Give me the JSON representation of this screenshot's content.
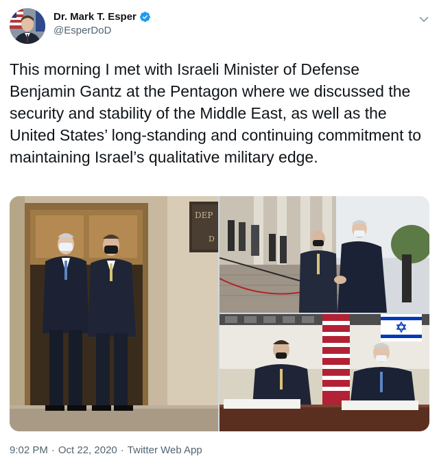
{
  "author": {
    "name": "Dr. Mark T. Esper",
    "handle": "@EsperDoD",
    "verified": true
  },
  "tweet": {
    "text": "This morning I met with Israeli Minister of Defense Benjamin Gantz at the Pentagon where we discussed the security and stability of the Middle East, as well as the United States’ long-standing and continuing commitment to maintaining Israel’s qualitative military edge."
  },
  "media": {
    "photo_count": 3,
    "photo1_sign_text": "DEP"
  },
  "footer": {
    "time": "9:02 PM",
    "separator1": "·",
    "date": "Oct 22, 2020",
    "separator2": "·",
    "source": "Twitter Web App"
  },
  "colors": {
    "verified_badge": "#1d9bf0",
    "text_primary": "#0f1419",
    "text_secondary": "#536471"
  },
  "icons": {
    "verified": "verified-badge-icon",
    "menu": "chevron-down-icon"
  }
}
